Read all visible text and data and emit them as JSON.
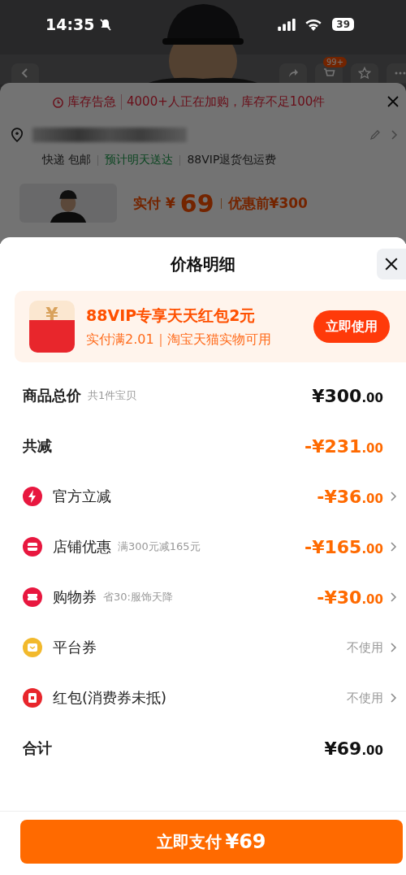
{
  "status_bar": {
    "time": "14:35",
    "battery": "39"
  },
  "product_page": {
    "cart_badge": "99+",
    "stock_alert": {
      "tag": "库存告急",
      "text": "4000+人正在加购，库存不足100件"
    },
    "shipping": [
      {
        "text": "快递 包邮",
        "kind": "plain"
      },
      {
        "text": "预计明天送达",
        "kind": "highlight"
      },
      {
        "text": "88VIP退货包运费",
        "kind": "plain"
      }
    ],
    "price": {
      "label": "实付",
      "currency": "¥",
      "amount": "69",
      "before": "优惠前¥300"
    }
  },
  "price_sheet": {
    "title": "价格明细",
    "promo": {
      "icon_text": "¥",
      "title": "88VIP专享天天红包2元",
      "subtitle": "实付满2.01｜淘宝天猫实物可用",
      "button": "立即使用"
    },
    "rows": [
      {
        "kind": "total",
        "label": "商品总价",
        "note": "共1件宝贝",
        "amount": "¥300",
        "cents": ".00"
      },
      {
        "kind": "reduction",
        "label": "共减",
        "amount": "-¥231",
        "cents": ".00"
      },
      {
        "kind": "deduction",
        "color": "#e8173f",
        "label": "官方立减",
        "amount": "-¥36",
        "cents": ".00"
      },
      {
        "kind": "deduction",
        "color": "#e8173f",
        "label": "店铺优惠",
        "note": "满300元减165元",
        "amount": "-¥165",
        "cents": ".00"
      },
      {
        "kind": "deduction",
        "color": "#e8173f",
        "label": "购物券",
        "note": "省30:服饰天降",
        "amount": "-¥30",
        "cents": ".00"
      },
      {
        "kind": "unused",
        "color": "#f2b92c",
        "label": "平台券",
        "amount": "不使用"
      },
      {
        "kind": "unused",
        "color": "#e8262c",
        "label": "红包(消费券未抵)",
        "amount": "不使用"
      },
      {
        "kind": "total",
        "label": "合计",
        "amount": "¥69",
        "cents": ".00"
      }
    ],
    "pay_button": {
      "label": "立即支付",
      "amount": "¥69"
    }
  }
}
